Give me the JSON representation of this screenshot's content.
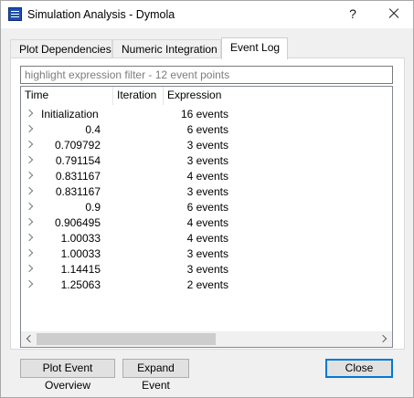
{
  "window": {
    "title": "Simulation Analysis - Dymola",
    "help_label": "?"
  },
  "tabs": [
    {
      "label": "Plot Dependencies",
      "active": false
    },
    {
      "label": "Numeric Integration",
      "active": false
    },
    {
      "label": "Event Log",
      "active": true
    }
  ],
  "filter": {
    "placeholder": "highlight expression filter - 12 event points",
    "value": ""
  },
  "table": {
    "columns": [
      "Time",
      "Iteration",
      "Expression"
    ],
    "rows": [
      {
        "time": "Initialization",
        "expression": "16 events"
      },
      {
        "time": "0.4",
        "expression": "6 events"
      },
      {
        "time": "0.709792",
        "expression": "3 events"
      },
      {
        "time": "0.791154",
        "expression": "3 events"
      },
      {
        "time": "0.831167",
        "expression": "4 events"
      },
      {
        "time": "0.831167",
        "expression": "3 events"
      },
      {
        "time": "0.9",
        "expression": "6 events"
      },
      {
        "time": "0.906495",
        "expression": "4 events"
      },
      {
        "time": "1.00033",
        "expression": "4 events"
      },
      {
        "time": "1.00033",
        "expression": "3 events"
      },
      {
        "time": "1.14415",
        "expression": "3 events"
      },
      {
        "time": "1.25063",
        "expression": "2 events"
      }
    ]
  },
  "buttons": {
    "plot_event_overview": "Plot Event Overview",
    "expand_event": "Expand Event",
    "close": "Close"
  },
  "colors": {
    "accent": "#0078d7",
    "app_icon": "#1b4fb0"
  }
}
